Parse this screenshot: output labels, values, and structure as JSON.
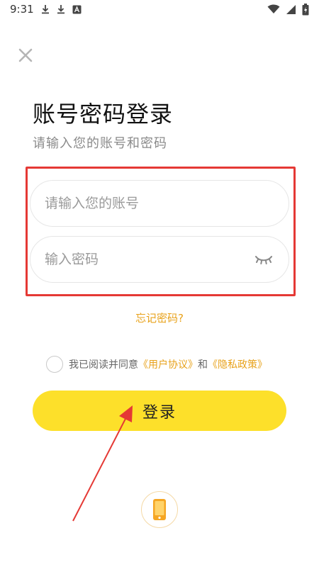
{
  "status_bar": {
    "time": "9:31",
    "icons": [
      "download-icon",
      "download-icon",
      "a-badge-icon",
      "wifi-icon",
      "signal-icon",
      "battery-charging-icon"
    ]
  },
  "header": {
    "close_icon": "close-icon",
    "title": "账号密码登录",
    "subtitle": "请输入您的账号和密码"
  },
  "form": {
    "account": {
      "value": "",
      "placeholder": "请输入您的账号"
    },
    "password": {
      "value": "",
      "placeholder": "输入密码",
      "toggle_icon": "eye-closed-icon"
    },
    "forgot_label": "忘记密码?"
  },
  "agreement": {
    "prefix": "我已阅读并同意",
    "user_agreement": "《用户协议》",
    "connector": "和",
    "privacy_policy": "《隐私政策》",
    "checked": false
  },
  "login_button": {
    "label": "登录"
  },
  "alt_login": {
    "icon": "phone-icon"
  },
  "colors": {
    "accent_yellow": "#fde02a",
    "link_orange": "#e8a21b",
    "highlight_red": "#e53935",
    "title_text": "#111111",
    "subtitle_text": "#8a8a8a"
  }
}
